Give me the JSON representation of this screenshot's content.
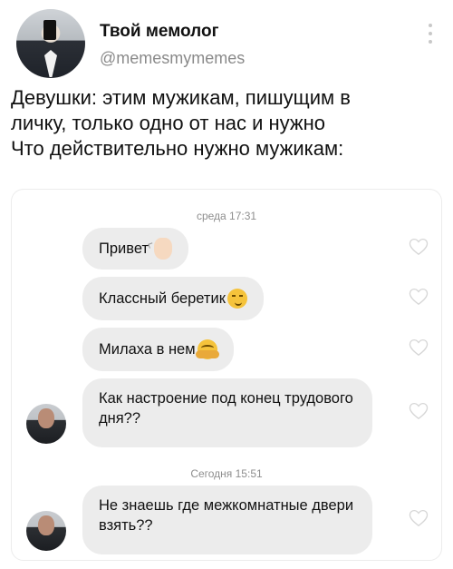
{
  "post": {
    "author_name": "Твой мемолог",
    "author_handle": "@memesmymemes",
    "text_lines": [
      "Девушки: этим мужикам, пишущим в",
      "личку, только одно от нас и нужно",
      "Что действительно нужно мужикам:"
    ]
  },
  "chat": {
    "timestamp_1": "среда 17:31",
    "timestamp_2": "Сегодня 15:51",
    "messages": [
      {
        "text": "Привет",
        "emoji": "waving-hand"
      },
      {
        "text": "Классный беретик",
        "emoji": "smirking-face"
      },
      {
        "text": "Милаха в нем",
        "emoji": "hugging-face"
      },
      {
        "text": "Как настроение под конец трудового дня??",
        "emoji": ""
      },
      {
        "text": "Не знаешь где межкомнатные двери взять??",
        "emoji": ""
      }
    ]
  },
  "colors": {
    "bubble": "#ececec",
    "handle": "#8a8a8a",
    "timestamp": "#8e8e8e",
    "heart_outline": "#d6d6d6"
  }
}
